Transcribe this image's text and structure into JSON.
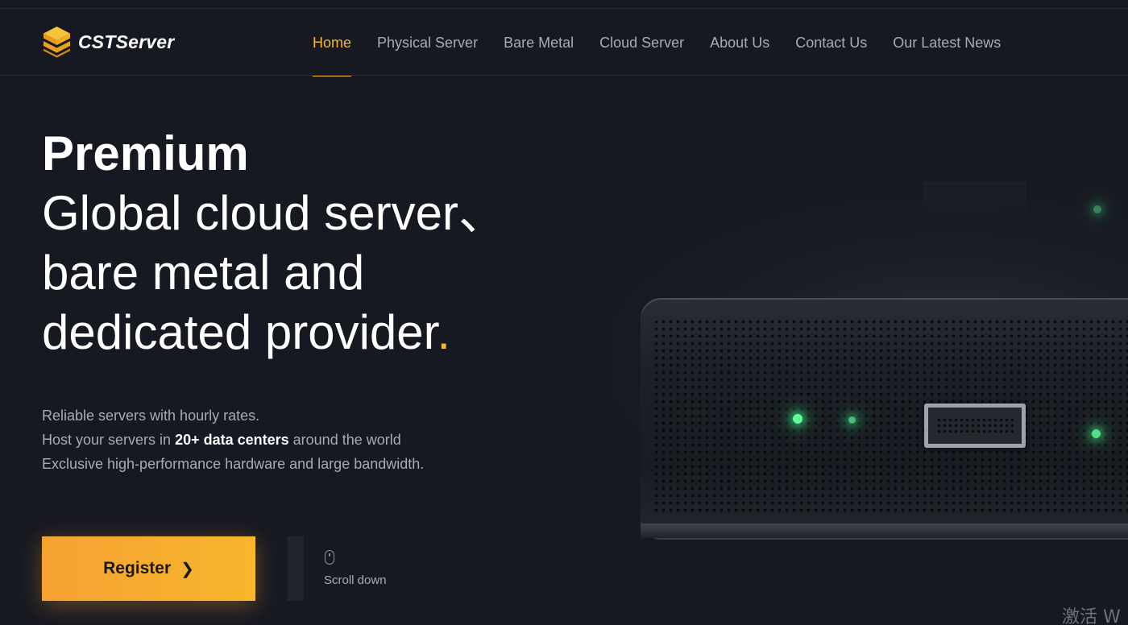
{
  "brand": {
    "name": "CSTServer",
    "accent": "#f5b53a"
  },
  "nav": {
    "items": [
      {
        "label": "Home",
        "active": true
      },
      {
        "label": "Physical Server",
        "active": false
      },
      {
        "label": "Bare Metal",
        "active": false
      },
      {
        "label": "Cloud Server",
        "active": false
      },
      {
        "label": "About Us",
        "active": false
      },
      {
        "label": "Contact Us",
        "active": false
      },
      {
        "label": "Our Latest News",
        "active": false
      }
    ]
  },
  "hero": {
    "title_bold": "Premium",
    "title_line2": "Global cloud server、",
    "title_line3": "bare metal and",
    "title_line4": "dedicated provider",
    "title_dot": ".",
    "desc_line1": "Reliable servers with hourly rates.",
    "desc_line2_pre": "Host your servers in ",
    "desc_line2_bold": "20+ data centers",
    "desc_line2_post": " around the world",
    "desc_line3": "Exclusive high-performance hardware and large bandwidth.",
    "register_label": "Register",
    "register_icon": "chevron-right-icon",
    "scroll_label": "Scroll down",
    "scroll_icon": "mouse-icon"
  },
  "watermark": "激活 W"
}
